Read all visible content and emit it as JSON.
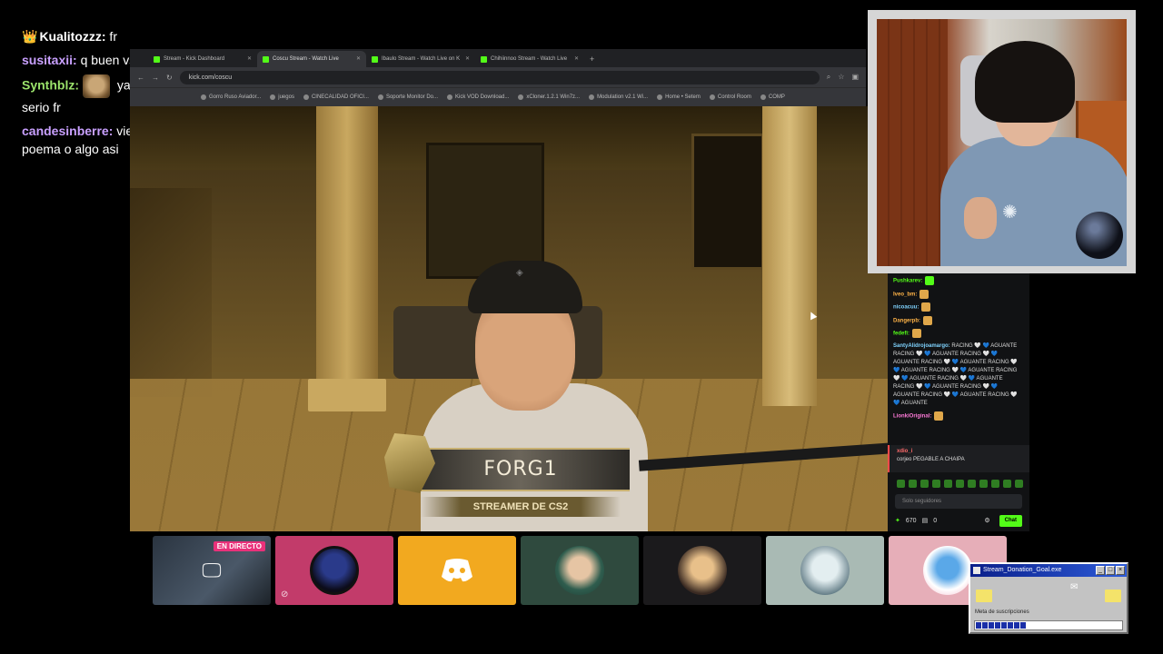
{
  "overlay_chat": [
    {
      "user": "Kualitozzz:",
      "text": " fr",
      "color": "#ffffff",
      "badge": "crown"
    },
    {
      "user": "susitaxii:",
      "text": " q buen vs",
      "color": "#c9a0ff"
    },
    {
      "user": "Synthblz:",
      "text": " ya no se lo toma en serio fr",
      "color": "#9be36b",
      "emote": true
    },
    {
      "user": "candesinberre:",
      "text": " vieron qe tita hizo un poema o algo asi",
      "color": "#c9a0ff"
    }
  ],
  "browser": {
    "tabs": [
      {
        "label": "Stream - Kick Dashboard",
        "active": false
      },
      {
        "label": "Coscu Stream - Watch Live",
        "active": true
      },
      {
        "label": "Ibaulo Stream - Watch Live on K",
        "active": false
      },
      {
        "label": "Chihiinnoo Stream - Watch Live",
        "active": false
      }
    ],
    "new_tab": "+",
    "url": "kick.com/coscu",
    "bookmarks": [
      "Gorro Ruso Aviador...",
      "juegos",
      "CINECALIDAD OFICI...",
      "Soporte Monitor Do...",
      "Kick VOD Download...",
      "xCloner.1.2.1 Win7z...",
      "Modulation v2.1 Wi...",
      "Home • Setem",
      "Control Room",
      "COMP"
    ]
  },
  "video": {
    "lower_third_name": "FORG1",
    "lower_third_subtitle": "STREAMER DE CS2"
  },
  "kick_chat": {
    "messages": [
      {
        "user": "Pushkarev:",
        "text": "",
        "cls": ""
      },
      {
        "user": "Iveo_bm:",
        "text": "",
        "cls": "u2"
      },
      {
        "user": "nicoacuu:",
        "text": "",
        "cls": "u3"
      },
      {
        "user": "Dangerpb:",
        "text": "",
        "cls": "u2"
      },
      {
        "user": "fedefi:",
        "text": "",
        "cls": ""
      },
      {
        "user": "SantyAlidrojoamargo:",
        "text": " RACING 🤍 💙 AGUANTE RACING 🤍 💙 AGUANTE RACING 🤍 💙 AGUANTE RACING 🤍 💙 AGUANTE RACING 🤍 💙 AGUANTE RACING 🤍 💙 AGUANTE RACING 🤍 💙 AGUANTE RACING 🤍 💙 AGUANTE RACING 🤍 💙 AGUANTE RACING 🤍 💙 AGUANTE RACING 🤍 💙 AGUANTE RACING 🤍 💙 AGUANTE",
        "cls": "u3"
      },
      {
        "user": "LionkiOriginal:",
        "text": "",
        "cls": "u4"
      }
    ],
    "pinned_user": "xdio_i",
    "pinned_text": "corjeo PEGABLE A CHAIPA",
    "input_placeholder": "Solo seguidores",
    "points": "670",
    "count": "0",
    "chat_button": "Chat"
  },
  "tiles": [
    {
      "name": "screen-share",
      "badge": "EN DIRECTO"
    },
    {
      "name": "ninja-avatar"
    },
    {
      "name": "discord"
    },
    {
      "name": "cap-avatar"
    },
    {
      "name": "blonde-avatar"
    },
    {
      "name": "anime-avatar"
    },
    {
      "name": "cartoon-avatar"
    }
  ],
  "goal_widget": {
    "title": "Stream_Donation_Goal.exe",
    "label": "Meta de suscripciones",
    "progress_segments": 8,
    "progress": 0.3
  },
  "colors": {
    "kick_green": "#53fc18",
    "live_pink": "#e9317a",
    "discord_yellow": "#f2a91f",
    "win_title_blue": "#0a1f8a"
  }
}
